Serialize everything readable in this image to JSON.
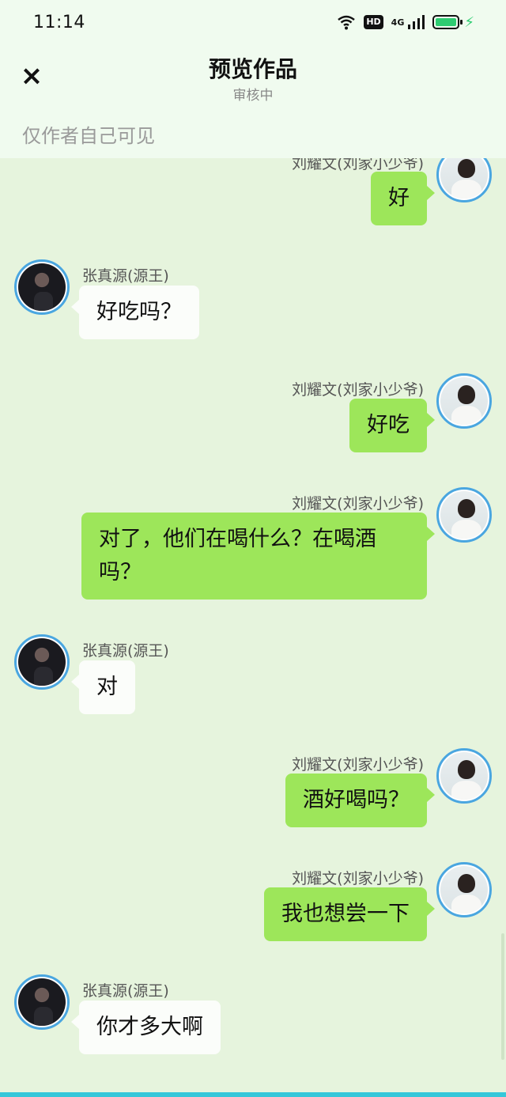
{
  "status_bar": {
    "time": "11:14",
    "hd": "HD",
    "network": "4G",
    "battery_level": 1.0,
    "battery_color": "#2ecc71"
  },
  "header": {
    "close_icon": "×",
    "title": "预览作品",
    "subtitle": "审核中",
    "visibility": "仅作者自己可见"
  },
  "colors": {
    "chat_background": "#e6f4dd",
    "my_bubble": "#9de65a",
    "other_bubble": "#fbfdfa",
    "avatar_border": "#4aa6e0"
  },
  "messages": [
    {
      "side": "me",
      "sender": "刘耀文(刘家小少爷)",
      "text": "好"
    },
    {
      "side": "other",
      "sender": "张真源(源王)",
      "text": "好吃吗？"
    },
    {
      "side": "me",
      "sender": "刘耀文(刘家小少爷)",
      "text": "好吃"
    },
    {
      "side": "me",
      "sender": "刘耀文(刘家小少爷)",
      "text": "对了，他们在喝什么？在喝酒吗？"
    },
    {
      "side": "other",
      "sender": "张真源(源王)",
      "text": "对"
    },
    {
      "side": "me",
      "sender": "刘耀文(刘家小少爷)",
      "text": "酒好喝吗？"
    },
    {
      "side": "me",
      "sender": "刘耀文(刘家小少爷)",
      "text": "我也想尝一下"
    },
    {
      "side": "other",
      "sender": "张真源(源王)",
      "text": "你才多大啊"
    }
  ]
}
